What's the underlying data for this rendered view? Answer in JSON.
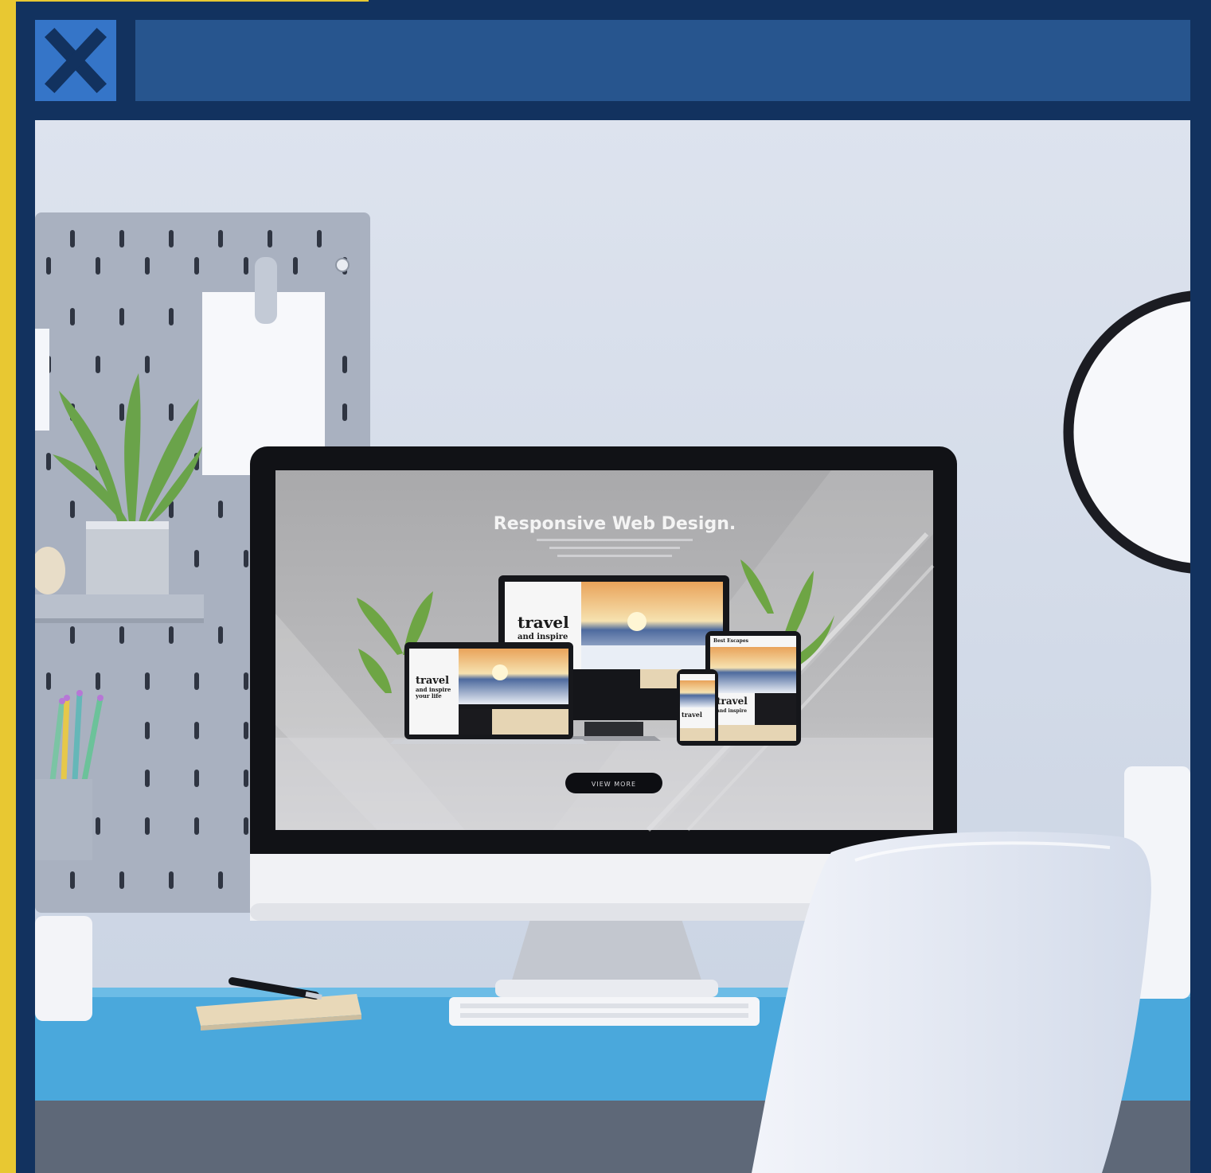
{
  "window": {
    "title": "",
    "close_icon": "close-icon"
  },
  "photo": {
    "screen_headline": "Responsive Web Design.",
    "screen_button_label": "VIEW MORE",
    "device_headline": "travel",
    "device_subline_1": "and inspire",
    "device_subline_2": "your life",
    "device_brand": "Best Escapes"
  },
  "colors": {
    "frame": "#12325f",
    "accent_yellow": "#e8c832",
    "close_button": "#3575c8",
    "title_bar": "#27558e",
    "desk": "#4aa8dc"
  }
}
